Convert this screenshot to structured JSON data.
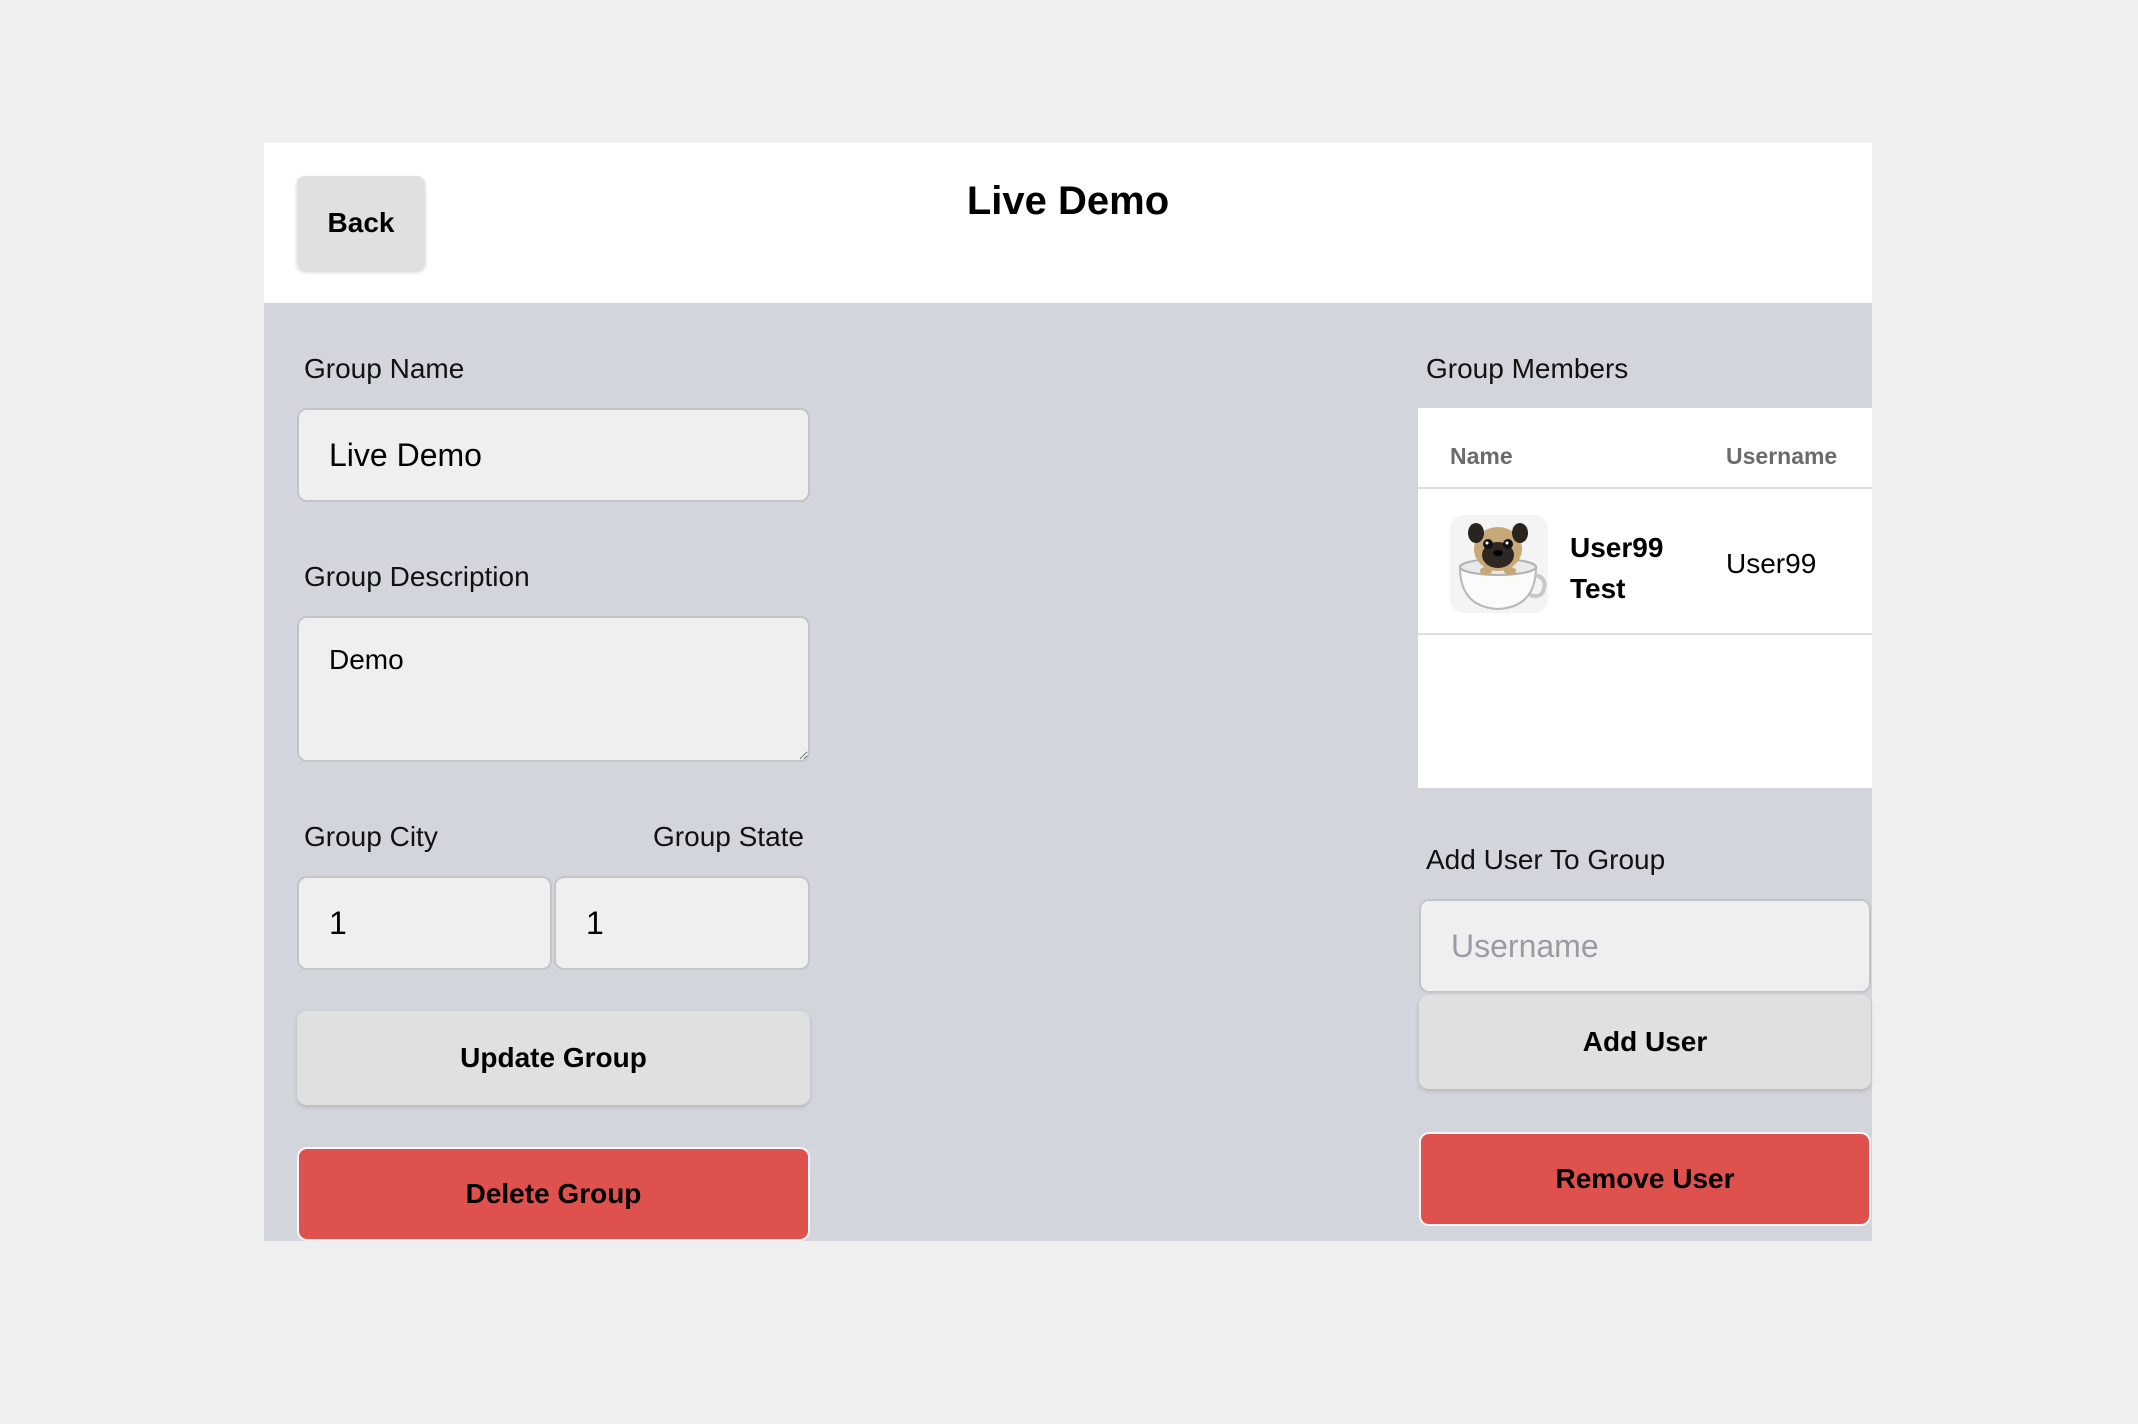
{
  "header": {
    "back_label": "Back",
    "title": "Live Demo"
  },
  "form": {
    "group_name_label": "Group Name",
    "group_name_value": "Live Demo",
    "group_description_label": "Group Description",
    "group_description_value": "Demo",
    "group_city_label": "Group City",
    "group_city_value": "1",
    "group_state_label": "Group State",
    "group_state_value": "1",
    "update_label": "Update Group",
    "delete_label": "Delete Group"
  },
  "members": {
    "title": "Group Members",
    "columns": [
      "Name",
      "Username"
    ],
    "rows": [
      {
        "name_line1": "User99",
        "name_line2": "Test",
        "username": "User99",
        "avatar": "pug-in-cup-photo"
      }
    ]
  },
  "add_user": {
    "label": "Add User To Group",
    "placeholder": "Username",
    "add_label": "Add User",
    "remove_label": "Remove User"
  },
  "colors": {
    "page_bg": "#f0eff0",
    "panel_bg": "#d2d5dc",
    "danger": "#df514d",
    "button_grey": "#e0e0e0"
  }
}
